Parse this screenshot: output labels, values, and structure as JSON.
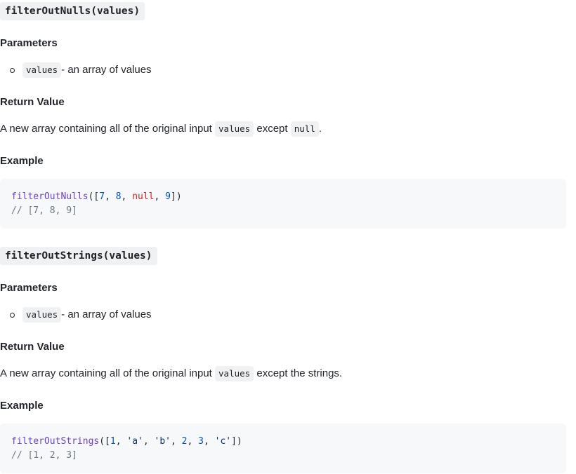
{
  "sections": [
    {
      "heading": "filterOutNulls(values)",
      "params_label": "Parameters",
      "param_name": "values",
      "param_desc": " - an array of values",
      "return_label": "Return Value",
      "return_text_before": "A new array containing all of the original input ",
      "return_code": "values",
      "return_text_middle": " except ",
      "return_code2": "null",
      "return_text_after": ".",
      "example_label": "Example",
      "code_call": {
        "fn": "filterOutNulls",
        "open": "([",
        "a": "7",
        "sep1": ", ",
        "b": "8",
        "sep2": ", ",
        "c": "null",
        "sep3": ", ",
        "d": "9",
        "close": "])"
      },
      "code_comment": "// [7, 8, 9]"
    },
    {
      "heading": "filterOutStrings(values)",
      "params_label": "Parameters",
      "param_name": "values",
      "param_desc": " - an array of values",
      "return_label": "Return Value",
      "return_text_before": "A new array containing all of the original input ",
      "return_code": "values",
      "return_text_after": " except the strings.",
      "example_label": "Example",
      "code_call": {
        "fn": "filterOutStrings",
        "open": "([",
        "v1": "1",
        "sep1": ", ",
        "v2": "'a'",
        "sep2": ", ",
        "v3": "'b'",
        "sep3": ", ",
        "v4": "2",
        "sep4": ", ",
        "v5": "3",
        "sep5": ", ",
        "v6": "'c'",
        "close": "])"
      },
      "code_comment": "// [1, 2, 3]"
    }
  ]
}
